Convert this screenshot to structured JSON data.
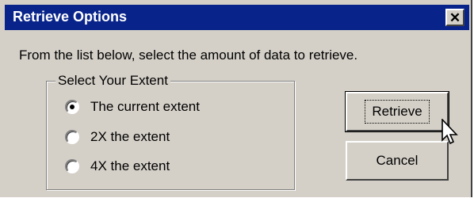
{
  "dialog": {
    "title": "Retrieve Options",
    "close_glyph": "✕",
    "instruction": "From the list below, select the amount of data to retrieve.",
    "group_label": "Select Your Extent",
    "options": [
      {
        "label": "The current extent",
        "checked": true
      },
      {
        "label": "2X the extent",
        "checked": false
      },
      {
        "label": "4X the extent",
        "checked": false
      }
    ],
    "retrieve_label": "Retrieve",
    "cancel_label": "Cancel"
  },
  "colors": {
    "titlebar": "#08248a",
    "face": "#d4d0c8"
  },
  "icons": {
    "cursor": "arrow-cursor-icon",
    "close": "close-icon"
  }
}
